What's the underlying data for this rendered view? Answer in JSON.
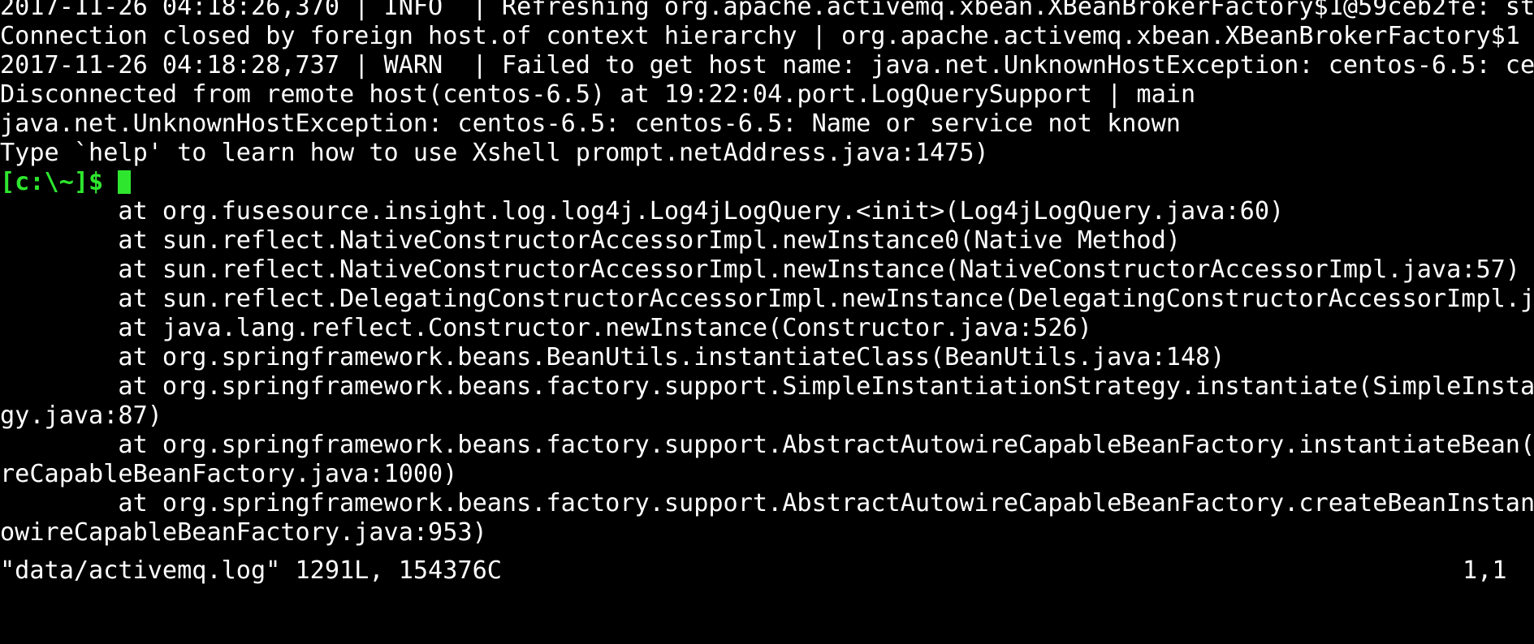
{
  "terminal": {
    "lines": [
      "2017-11-26 04:18:26,370 | INFO  | Refreshing org.apache.activemq.xbean.XBeanBrokerFactory$1@59ceb2fe: st",
      "Connection closed by foreign host.of context hierarchy | org.apache.activemq.xbean.XBeanBrokerFactory$1",
      "2017-11-26 04:18:28,737 | WARN  | Failed to get host name: java.net.UnknownHostException: centos-6.5: ce",
      "Disconnected from remote host(centos-6.5) at 19:22:04.port.LogQuerySupport | main",
      "java.net.UnknownHostException: centos-6.5: centos-6.5: Name or service not known",
      "Type `help' to learn how to use Xshell prompt.netAddress.java:1475)"
    ],
    "prompt": "[c:\\~]$",
    "stack_lines": [
      "        at org.fusesource.insight.log.log4j.Log4jLogQuery.<init>(Log4jLogQuery.java:60)",
      "        at sun.reflect.NativeConstructorAccessorImpl.newInstance0(Native Method)",
      "        at sun.reflect.NativeConstructorAccessorImpl.newInstance(NativeConstructorAccessorImpl.java:57)",
      "        at sun.reflect.DelegatingConstructorAccessorImpl.newInstance(DelegatingConstructorAccessorImpl.j",
      "        at java.lang.reflect.Constructor.newInstance(Constructor.java:526)",
      "        at org.springframework.beans.BeanUtils.instantiateClass(BeanUtils.java:148)",
      "        at org.springframework.beans.factory.support.SimpleInstantiationStrategy.instantiate(SimpleInsta",
      "gy.java:87)",
      "        at org.springframework.beans.factory.support.AbstractAutowireCapableBeanFactory.instantiateBean(",
      "reCapableBeanFactory.java:1000)",
      "        at org.springframework.beans.factory.support.AbstractAutowireCapableBeanFactory.createBeanInstan",
      "owireCapableBeanFactory.java:953)"
    ],
    "status": {
      "file": "\"data/activemq.log\" 1291L, 154376C",
      "position": "1,1"
    }
  },
  "colors": {
    "background": "#000000",
    "text": "#ffffff",
    "prompt": "#2ee62e",
    "cursor": "#2ee62e"
  }
}
